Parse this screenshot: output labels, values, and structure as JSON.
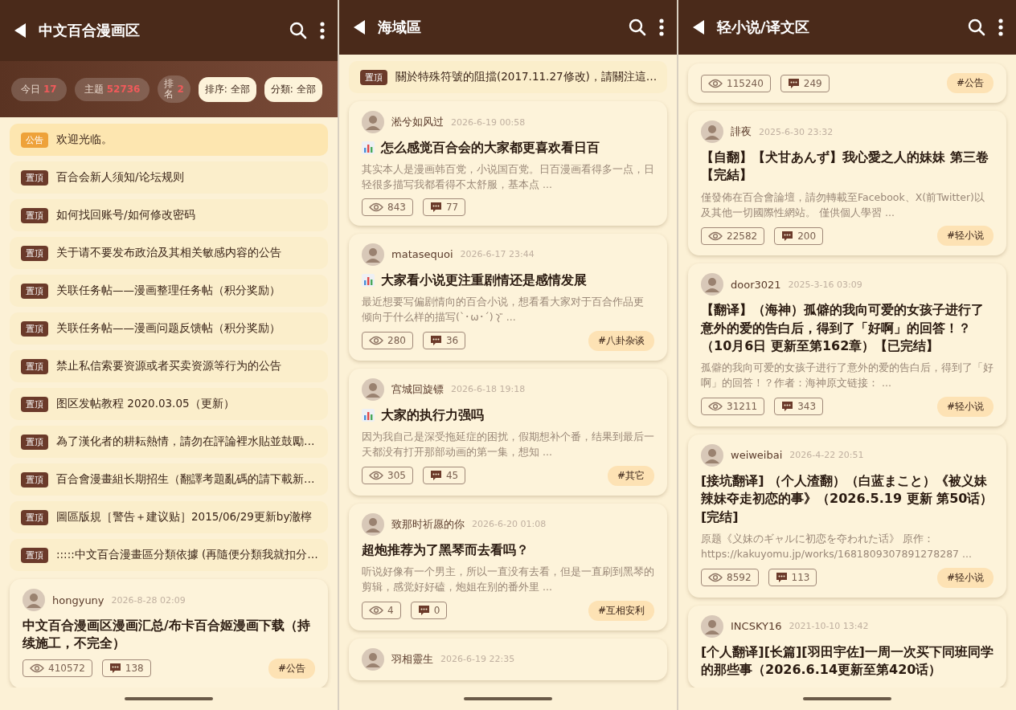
{
  "screens": [
    {
      "title": "中文百合漫画区",
      "stats": [
        {
          "label": "今日",
          "value": "17"
        },
        {
          "label": "主题",
          "value": "52736"
        },
        {
          "label": "排名",
          "value": "2",
          "kind": "vertical"
        }
      ],
      "filters": [
        "排序: 全部",
        "分類: 全部"
      ],
      "pinned": [
        {
          "kind": "announce",
          "tag": "公告",
          "text": "欢迎光临。"
        },
        {
          "kind": "pinned",
          "tag": "置頂",
          "text": "百合会新人须知/论坛规则"
        },
        {
          "kind": "pinned",
          "tag": "置頂",
          "text": "如何找回账号/如何修改密码"
        },
        {
          "kind": "pinned",
          "tag": "置頂",
          "text": "关于请不要发布政治及其相关敏感内容的公告"
        },
        {
          "kind": "pinned",
          "tag": "置頂",
          "text": "关联任务帖——漫画整理任务帖（积分奖励）"
        },
        {
          "kind": "pinned",
          "tag": "置頂",
          "text": "关联任务帖——漫画问题反馈帖（积分奖励）"
        },
        {
          "kind": "pinned",
          "tag": "置頂",
          "text": "禁止私信索要资源或者买卖资源等行为的公告"
        },
        {
          "kind": "pinned",
          "tag": "置頂",
          "text": "图区发帖教程 2020.03.05（更新）"
        },
        {
          "kind": "pinned",
          "tag": "置頂",
          "text": "為了漢化者的耕耘熱情，請勿在評論裡水貼並鼓勵…"
        },
        {
          "kind": "pinned",
          "tag": "置頂",
          "text": "百合會漫畫組长期招生（翻譯考題亂碼的請下載新…"
        },
        {
          "kind": "pinned",
          "tag": "置頂",
          "text": "圖區版規［警告＋建议贴］2015/06/29更新by澈檸"
        },
        {
          "kind": "pinned",
          "tag": "置頂",
          "text": ":::::中文百合漫畫區分類依據 (再隨便分類我就扣分…"
        }
      ],
      "posts": [
        {
          "author": "hongyuny",
          "date": "2026-8-28 02:09",
          "poll": false,
          "title": "中文百合漫画区漫画汇总/布卡百合姬漫画下载（持续施工，不完全）",
          "views": "410572",
          "comments": "138",
          "tag": "#公告"
        }
      ]
    },
    {
      "title": "海域區",
      "pinned": [
        {
          "kind": "pinned",
          "tag": "置頂",
          "text": "關於特殊符號的阻擋(2017.11.27修改)，請關注這…"
        }
      ],
      "posts": [
        {
          "author": "淞兮如风过",
          "date": "2026-6-19 00:58",
          "poll": true,
          "title": "怎么感觉百合会的大家都更喜欢看日百",
          "excerpt": "其实本人是漫画韩百党，小说国百党。日百漫画看得多一点，日轻很多描写我都看得不太舒服，基本点 ...",
          "views": "843",
          "comments": "77"
        },
        {
          "author": "matasequoi",
          "date": "2026-6-17 23:44",
          "poll": true,
          "title": "大家看小说更注重剧情还是感情发展",
          "excerpt_lines": [
            "最近想要写偏剧情向的百合小说，想看看大家对于百合作品更",
            "倾向于什么样的描写(`･ω･´)"
          ],
          "excerpt_mark": true,
          "excerpt_tail": "...",
          "views": "280",
          "comments": "36",
          "tag": "#八卦杂谈"
        },
        {
          "author": "宫城回旋镖",
          "date": "2026-6-18 19:18",
          "poll": true,
          "title": "大家的执行力强吗",
          "excerpt": "因为我自己是深受拖延症的困扰，假期想补个番，结果到最后一天都没有打开那部动画的第一集，想知 ...",
          "views": "305",
          "comments": "45",
          "tag": "#其它"
        },
        {
          "author": "致那时祈愿的你",
          "date": "2026-6-20 01:08",
          "poll": false,
          "title": "超炮推荐为了黑琴而去看吗？",
          "excerpt": "听说好像有一个男主，所以一直没有去看，但是一直刷到黑琴的剪辑，感觉好好磕，炮姐在别的番外里 ...",
          "views": "4",
          "comments": "0",
          "tag": "#互相安利"
        },
        {
          "author": "羽相靈生",
          "date": "2026-6-19 22:35"
        }
      ]
    },
    {
      "title": "轻小说/译文区",
      "posts": [
        {
          "views": "115240",
          "comments": "249",
          "tag": "#公告"
        },
        {
          "author": "誹夜",
          "date": "2025-6-30 23:32",
          "poll": false,
          "title": "【自翻】【犬甘あんず】我心愛之人的妹妹 第三卷【完結】",
          "excerpt": "僅發佈在百合會論壇，請勿轉載至Facebook、X(前Twitter)以及其他一切國際性網站。 僅供個人學習 ...",
          "views": "22582",
          "comments": "200",
          "tag": "#轻小说"
        },
        {
          "author": "door3021",
          "date": "2025-3-16 03:09",
          "poll": false,
          "title": "【翻译】（海神）孤僻的我向可爱的女孩子进行了意外的爱的告白后，得到了「好啊」的回答！？（10月6日 更新至第162章）【已完结】",
          "excerpt": "孤僻的我向可爱的女孩子进行了意外的爱的告白后，得到了「好啊」的回答！？作者：海神原文链接： ...",
          "views": "31211",
          "comments": "343",
          "tag": "#轻小说"
        },
        {
          "author": "weiweibai",
          "date": "2026-4-22 20:51",
          "poll": false,
          "title": "[接坑翻译] （个人渣翻）（白蓝まこと）《被义妹辣妹夺走初恋的事》（2026.5.19 更新 第50话）[完结]",
          "excerpt": "原题《义妹のギャルに初恋を夺われた话》 原作：https://kakuyomu.jp/works/1681809307891278287 ...",
          "views": "8592",
          "comments": "113",
          "tag": "#轻小说"
        },
        {
          "author": "INCSKY16",
          "date": "2021-10-10 13:42",
          "poll": false,
          "title": "[个人翻译][长篇][羽田宇佐]一周一次买下同班同学的那些事（2026.6.14更新至第420话）"
        }
      ]
    }
  ]
}
